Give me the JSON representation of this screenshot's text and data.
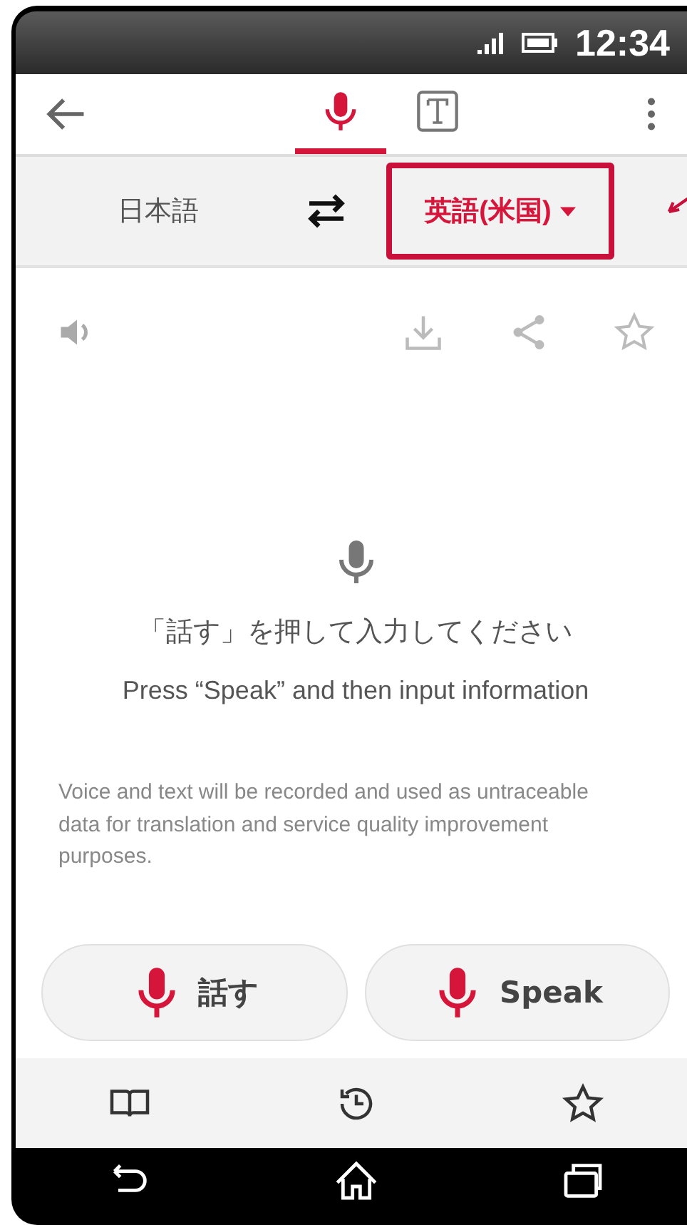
{
  "status_bar": {
    "time": "12:34"
  },
  "tabs": [
    {
      "kind": "voice",
      "selected": true
    },
    {
      "kind": "text",
      "selected": false
    }
  ],
  "languages": {
    "source": "日本語",
    "target": "英語(米国)",
    "target_highlighted": true
  },
  "prompt": {
    "japanese": "「話す」を押して入力してください",
    "english": "Press “Speak” and then input information"
  },
  "notice": "Voice and text will be recorded and used as untraceable data for translation and service quality improvement purposes.",
  "speak_buttons": [
    {
      "label": "話す"
    },
    {
      "label": "Speak"
    }
  ],
  "bottom_nav": [
    {
      "kind": "dictionary"
    },
    {
      "kind": "history"
    },
    {
      "kind": "favorites"
    }
  ]
}
